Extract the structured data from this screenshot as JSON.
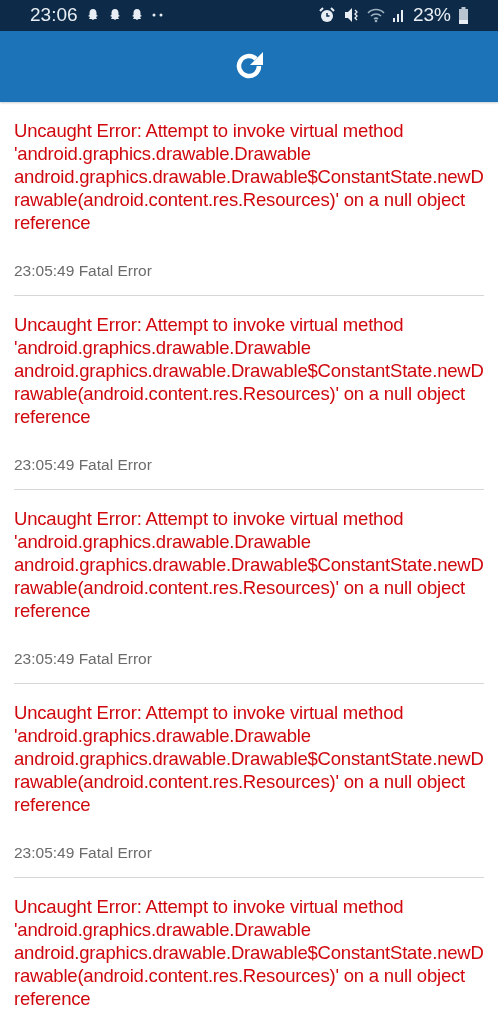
{
  "status_bar": {
    "time": "23:06",
    "battery": "23%"
  },
  "errors": [
    {
      "message": "Uncaught Error: Attempt to invoke virtual method 'android.graphics.drawable.Drawable android.graphics.drawable.Drawable$ConstantState.newDrawable(android.content.res.Resources)' on a null object reference",
      "time": "23:05:49 Fatal Error"
    },
    {
      "message": "Uncaught Error: Attempt to invoke virtual method 'android.graphics.drawable.Drawable android.graphics.drawable.Drawable$ConstantState.newDrawable(android.content.res.Resources)' on a null object reference",
      "time": "23:05:49 Fatal Error"
    },
    {
      "message": "Uncaught Error: Attempt to invoke virtual method 'android.graphics.drawable.Drawable android.graphics.drawable.Drawable$ConstantState.newDrawable(android.content.res.Resources)' on a null object reference",
      "time": "23:05:49 Fatal Error"
    },
    {
      "message": "Uncaught Error: Attempt to invoke virtual method 'android.graphics.drawable.Drawable android.graphics.drawable.Drawable$ConstantState.newDrawable(android.content.res.Resources)' on a null object reference",
      "time": "23:05:49 Fatal Error"
    },
    {
      "message": "Uncaught Error: Attempt to invoke virtual method 'android.graphics.drawable.Drawable android.graphics.drawable.Drawable$ConstantState.newDrawable(android.content.res.Resources)' on a null object reference"
    }
  ]
}
